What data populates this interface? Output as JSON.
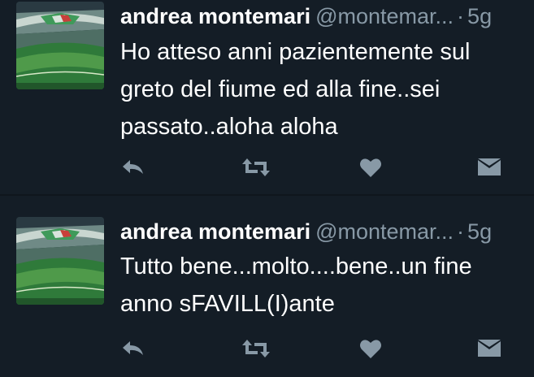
{
  "colors": {
    "background": "#141d26",
    "text": "#ffffff",
    "muted": "#8899a6",
    "icon": "#8899a6",
    "divider": "#0f161d"
  },
  "tweets": [
    {
      "author_name": "andrea montemari",
      "handle": "@montemar...",
      "separator": "·",
      "time": "5g",
      "text": "Ho atteso anni pazientemente sul\ngreto del fiume ed alla fine..sei\npassato..aloha aloha",
      "avatar": "stadium-photo"
    },
    {
      "author_name": "andrea montemari",
      "handle": "@montemar...",
      "separator": "·",
      "time": "5g",
      "text": "Tutto bene...molto....bene..un fine\nanno sFAVILL(I)ante",
      "avatar": "stadium-photo"
    }
  ],
  "action_icons": [
    "reply-icon",
    "retweet-icon",
    "like-icon",
    "direct-message-icon"
  ]
}
